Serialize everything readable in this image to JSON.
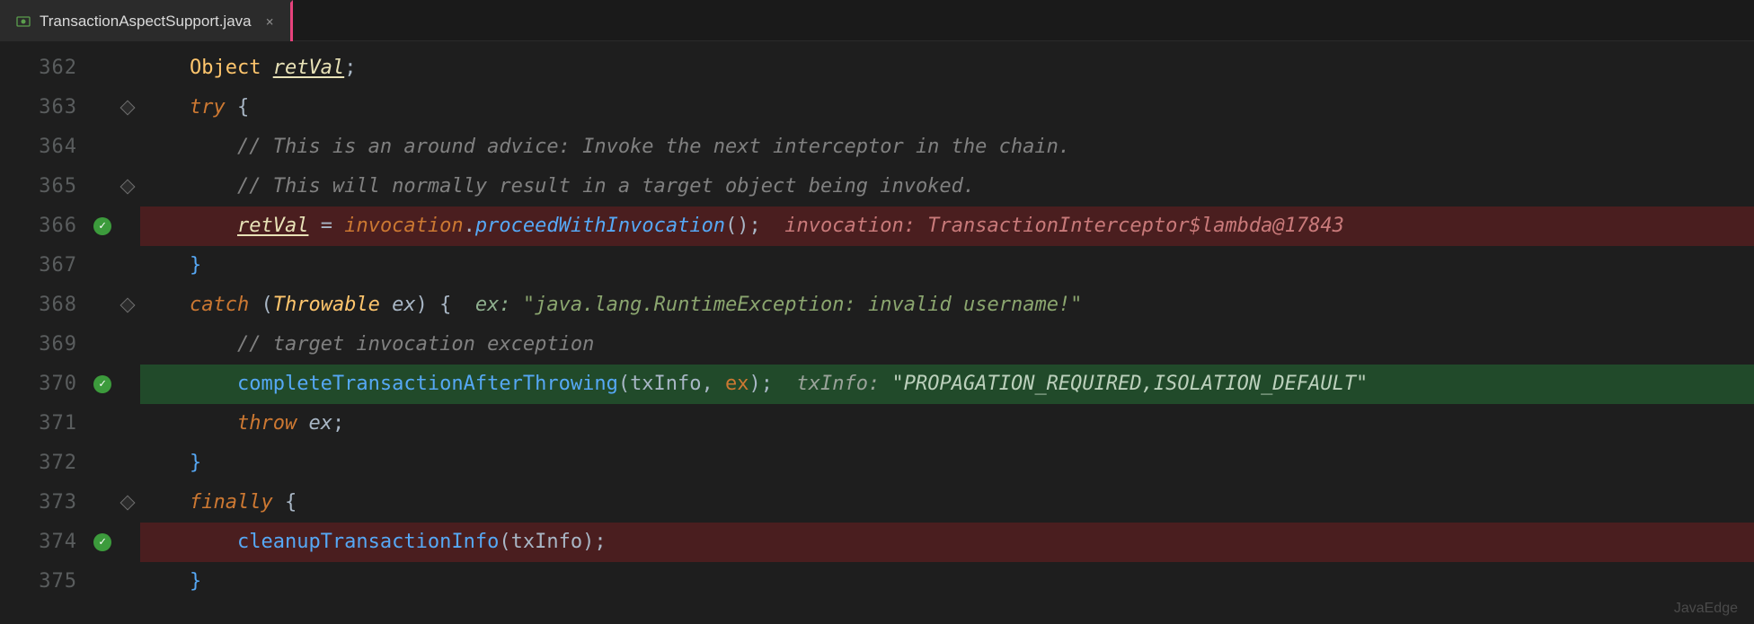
{
  "tab": {
    "label": "TransactionAspectSupport.java",
    "close": "×"
  },
  "watermark": "JavaEdge",
  "lines": {
    "l362": {
      "num": "362",
      "indent": "    ",
      "t_type": "Object ",
      "t_var": "retVal",
      "t_semi": ";"
    },
    "l363": {
      "num": "363",
      "indent": "    ",
      "t_kw": "try ",
      "t_brace": "{"
    },
    "l364": {
      "num": "364",
      "indent": "        ",
      "t_comment": "// This is an around advice: Invoke the next interceptor in the chain."
    },
    "l365": {
      "num": "365",
      "indent": "        ",
      "t_comment": "// This will normally result in a target object being invoked."
    },
    "l366": {
      "num": "366",
      "indent": "        ",
      "t_var": "retVal",
      "t_eq": " = ",
      "t_obj": "invocation",
      "t_dot": ".",
      "t_method": "proceedWithInvocation",
      "t_paren": "();",
      "t_hint_label": "  invocation: ",
      "t_hint_val": "TransactionInterceptor$lambda@17843"
    },
    "l367": {
      "num": "367",
      "indent": "    ",
      "t_brace": "}"
    },
    "l368": {
      "num": "368",
      "indent": "    ",
      "t_kw": "catch ",
      "t_open": "(",
      "t_type": "Throwable ",
      "t_var": "ex",
      "t_close": ") ",
      "t_brace": "{",
      "t_hint_label": "  ex: ",
      "t_hint_val": "\"java.lang.RuntimeException: invalid username!\""
    },
    "l369": {
      "num": "369",
      "indent": "        ",
      "t_comment": "// target invocation exception"
    },
    "l370": {
      "num": "370",
      "indent": "        ",
      "t_method": "completeTransactionAfterThrowing",
      "t_open": "(",
      "t_arg1": "txInfo",
      "t_comma": ", ",
      "t_arg2": "ex",
      "t_close": ");",
      "t_hint_label": "  txInfo: ",
      "t_hint_val": "\"PROPAGATION_REQUIRED,ISOLATION_DEFAULT\""
    },
    "l371": {
      "num": "371",
      "indent": "        ",
      "t_kw": "throw ",
      "t_var": "ex",
      "t_semi": ";"
    },
    "l372": {
      "num": "372",
      "indent": "    ",
      "t_brace": "}"
    },
    "l373": {
      "num": "373",
      "indent": "    ",
      "t_kw": "finally ",
      "t_brace": "{"
    },
    "l374": {
      "num": "374",
      "indent": "        ",
      "t_method": "cleanupTransactionInfo",
      "t_open": "(",
      "t_arg1": "txInfo",
      "t_close": ");"
    },
    "l375": {
      "num": "375",
      "indent": "    ",
      "t_brace": "}"
    }
  }
}
